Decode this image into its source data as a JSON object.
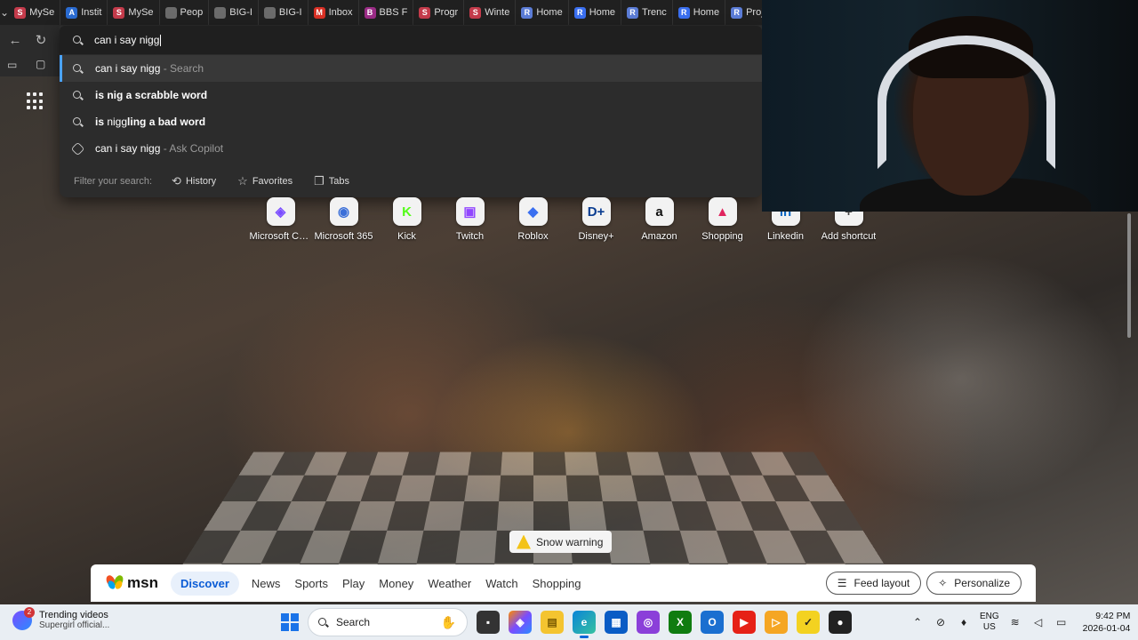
{
  "tabs": [
    {
      "label": "MySe",
      "icon": "shein-icon",
      "color": "#c43b4b",
      "letter": "S"
    },
    {
      "label": "Instit",
      "icon": "institution-icon",
      "color": "#2a6bd1",
      "letter": "A"
    },
    {
      "label": "MySe",
      "icon": "shein-icon",
      "color": "#c43b4b",
      "letter": "S"
    },
    {
      "label": "Peop",
      "icon": "page-icon",
      "color": "#6b6b6b",
      "letter": ""
    },
    {
      "label": "BIG-I",
      "icon": "page-icon",
      "color": "#6b6b6b",
      "letter": ""
    },
    {
      "label": "BIG-I",
      "icon": "page-icon",
      "color": "#6b6b6b",
      "letter": ""
    },
    {
      "label": "Inbox",
      "icon": "gmail-icon",
      "color": "#d93025",
      "letter": "M"
    },
    {
      "label": "BBS F",
      "icon": "bbs-icon",
      "color": "#9b2c86",
      "letter": "B"
    },
    {
      "label": "Progr",
      "icon": "shein-icon",
      "color": "#c43b4b",
      "letter": "S"
    },
    {
      "label": "Winte",
      "icon": "shein-icon",
      "color": "#c43b4b",
      "letter": "S"
    },
    {
      "label": "Home",
      "icon": "roblox-icon",
      "color": "#5b7cd6",
      "letter": "R"
    },
    {
      "label": "Home",
      "icon": "roblox-icon",
      "color": "#3a6ff0",
      "letter": "R"
    },
    {
      "label": "Trenc",
      "icon": "roblox-icon",
      "color": "#5b7cd6",
      "letter": "R"
    },
    {
      "label": "Home",
      "icon": "roblox-icon",
      "color": "#3a6ff0",
      "letter": "R"
    },
    {
      "label": "Proje",
      "icon": "roblox-icon",
      "color": "#5b7cd6",
      "letter": "R"
    }
  ],
  "omnibox": {
    "query": "can i say nigg",
    "suggestions": [
      {
        "bold": "",
        "normal": "can i say nigg",
        "suffix": " - Search",
        "icon": "search-icon"
      },
      {
        "bold_prefix": "is ",
        "normal": "nig",
        "bold": " a scrabble word",
        "icon": "search-icon"
      },
      {
        "bold_prefix": "is ",
        "normal": "nigg",
        "bold": "ling a bad word",
        "icon": "search-icon"
      },
      {
        "normal": "can i say nigg",
        "suffix": " - Ask Copilot",
        "icon": "copilot-icon"
      }
    ],
    "filter_label": "Filter your search:",
    "filters": [
      {
        "label": "History",
        "icon": "history-icon"
      },
      {
        "label": "Favorites",
        "icon": "star-icon"
      },
      {
        "label": "Tabs",
        "icon": "tabs-icon"
      }
    ]
  },
  "shortcuts": [
    {
      "label": "Microsoft Co...",
      "icon": "copilot-icon",
      "glyph": "◈",
      "color": "#7a4cff"
    },
    {
      "label": "Microsoft 365",
      "icon": "m365-icon",
      "glyph": "◉",
      "color": "#3b6fd8"
    },
    {
      "label": "Kick",
      "icon": "kick-icon",
      "glyph": "K",
      "color": "#53fc18"
    },
    {
      "label": "Twitch",
      "icon": "twitch-icon",
      "glyph": "▣",
      "color": "#9146ff"
    },
    {
      "label": "Roblox",
      "icon": "roblox-icon",
      "glyph": "◆",
      "color": "#3a6ff0"
    },
    {
      "label": "Disney+",
      "icon": "disney-icon",
      "glyph": "D+",
      "color": "#0b3d91"
    },
    {
      "label": "Amazon",
      "icon": "amazon-icon",
      "glyph": "a",
      "color": "#111111"
    },
    {
      "label": "Shopping",
      "icon": "shopping-bag-icon",
      "glyph": "▲",
      "color": "#e0245e"
    },
    {
      "label": "Linkedin",
      "icon": "linkedin-icon",
      "glyph": "in",
      "color": "#0a66c2"
    },
    {
      "label": "Add shortcut",
      "icon": "plus-icon",
      "glyph": "+",
      "color": "#444444"
    }
  ],
  "snow_warning": "Snow warning",
  "msn": {
    "logo": "msn",
    "nav": [
      "Discover",
      "News",
      "Sports",
      "Play",
      "Money",
      "Weather",
      "Watch",
      "Shopping"
    ],
    "active": "Discover",
    "feed_layout": "Feed layout",
    "personalize": "Personalize"
  },
  "taskbar": {
    "widget_title": "Trending videos",
    "widget_sub": "Supergirl official...",
    "widget_badge": "2",
    "search_label": "Search",
    "lang_top": "ENG",
    "lang_bottom": "US",
    "time": "9:42 PM",
    "date": "2026-01-04"
  }
}
